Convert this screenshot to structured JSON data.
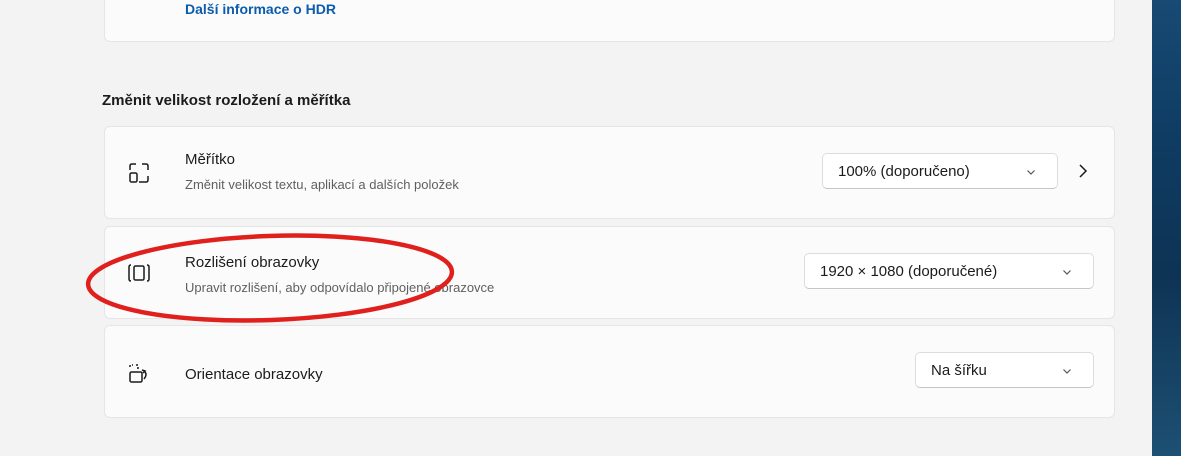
{
  "top_card": {
    "link_label": "Další informace o HDR"
  },
  "section": {
    "title": "Změnit velikost rozložení a měřítka"
  },
  "scale": {
    "title": "Měřítko",
    "subtitle": "Změnit velikost textu, aplikací a dalších položek",
    "value": "100% (doporučeno)",
    "icon": "scale-icon"
  },
  "resolution": {
    "title": "Rozlišení obrazovky",
    "subtitle": "Upravit rozlišení, aby odpovídalo připojené obrazovce",
    "value": "1920 × 1080 (doporučené)",
    "icon": "resolution-icon"
  },
  "orientation": {
    "title": "Orientace obrazovky",
    "value": "Na šířku",
    "icon": "orientation-icon"
  },
  "colors": {
    "background": "#f3f3f3",
    "card": "#fbfbfb",
    "link": "#0b5cad",
    "annotation": "#e0201c"
  }
}
